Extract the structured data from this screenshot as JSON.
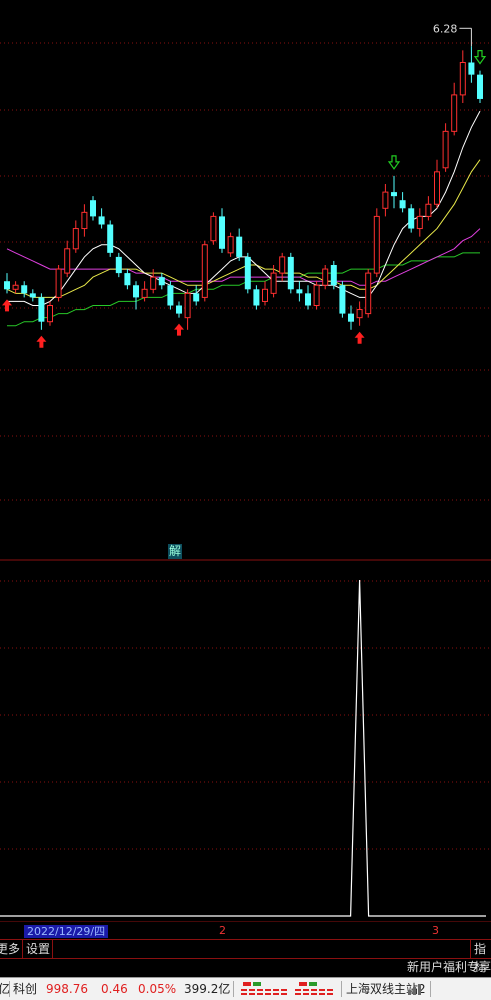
{
  "chart_top": {
    "max_price_label": "6.28",
    "candles": [
      {
        "o": 6,
        "c": 4,
        "h": 8,
        "l": 3
      },
      {
        "o": 4,
        "c": 5,
        "h": 6,
        "l": 3
      },
      {
        "o": 5,
        "c": 3,
        "h": 6,
        "l": 2
      },
      {
        "o": 3,
        "c": 2,
        "h": 4,
        "l": 1
      },
      {
        "o": 2,
        "c": -4,
        "h": 3,
        "l": -6
      },
      {
        "o": -4,
        "c": 0,
        "h": 1,
        "l": -5
      },
      {
        "o": 2,
        "c": 9,
        "h": 10,
        "l": 1
      },
      {
        "o": 8,
        "c": 14,
        "h": 16,
        "l": 7
      },
      {
        "o": 14,
        "c": 19,
        "h": 21,
        "l": 13
      },
      {
        "o": 19,
        "c": 23,
        "h": 25,
        "l": 17
      },
      {
        "o": 26,
        "c": 22,
        "h": 27,
        "l": 21
      },
      {
        "o": 22,
        "c": 20,
        "h": 24,
        "l": 19
      },
      {
        "o": 20,
        "c": 13,
        "h": 21,
        "l": 12
      },
      {
        "o": 12,
        "c": 8,
        "h": 13,
        "l": 7
      },
      {
        "o": 8,
        "c": 5,
        "h": 9,
        "l": 4
      },
      {
        "o": 5,
        "c": 2,
        "h": 6,
        "l": -1
      },
      {
        "o": 2,
        "c": 4,
        "h": 6,
        "l": 1
      },
      {
        "o": 4,
        "c": 7,
        "h": 9,
        "l": 3
      },
      {
        "o": 7,
        "c": 5,
        "h": 8,
        "l": 4
      },
      {
        "o": 5,
        "c": 0,
        "h": 6,
        "l": -1
      },
      {
        "o": 0,
        "c": -2,
        "h": 1,
        "l": -3
      },
      {
        "o": -3,
        "c": 3,
        "h": 4,
        "l": -6
      },
      {
        "o": 3,
        "c": 1,
        "h": 5,
        "l": 0
      },
      {
        "o": 2,
        "c": 15,
        "h": 16,
        "l": 1
      },
      {
        "o": 16,
        "c": 22,
        "h": 23,
        "l": 15
      },
      {
        "o": 22,
        "c": 14,
        "h": 24,
        "l": 13
      },
      {
        "o": 13,
        "c": 17,
        "h": 18,
        "l": 12
      },
      {
        "o": 17,
        "c": 12,
        "h": 19,
        "l": 11
      },
      {
        "o": 12,
        "c": 4,
        "h": 13,
        "l": 3
      },
      {
        "o": 4,
        "c": 0,
        "h": 5,
        "l": -1
      },
      {
        "o": 1,
        "c": 4,
        "h": 6,
        "l": 0
      },
      {
        "o": 3,
        "c": 8,
        "h": 10,
        "l": 2
      },
      {
        "o": 8,
        "c": 12,
        "h": 13,
        "l": 6
      },
      {
        "o": 12,
        "c": 4,
        "h": 13,
        "l": 3
      },
      {
        "o": 4,
        "c": 3,
        "h": 6,
        "l": 1
      },
      {
        "o": 3,
        "c": 0,
        "h": 5,
        "l": -1
      },
      {
        "o": 0,
        "c": 5,
        "h": 6,
        "l": -1
      },
      {
        "o": 5,
        "c": 9,
        "h": 10,
        "l": 4
      },
      {
        "o": 10,
        "c": 5,
        "h": 11,
        "l": 4
      },
      {
        "o": 5,
        "c": -2,
        "h": 6,
        "l": -3
      },
      {
        "o": -2,
        "c": -4,
        "h": 0,
        "l": -6
      },
      {
        "o": -3,
        "c": -1,
        "h": 1,
        "l": -5
      },
      {
        "o": -2,
        "c": 8,
        "h": 9,
        "l": -3
      },
      {
        "o": 8,
        "c": 22,
        "h": 24,
        "l": 7
      },
      {
        "o": 24,
        "c": 28,
        "h": 30,
        "l": 22
      },
      {
        "o": 28,
        "c": 27,
        "h": 32,
        "l": 24
      },
      {
        "o": 26,
        "c": 24,
        "h": 28,
        "l": 23
      },
      {
        "o": 24,
        "c": 19,
        "h": 25,
        "l": 18
      },
      {
        "o": 19,
        "c": 22,
        "h": 24,
        "l": 17
      },
      {
        "o": 22,
        "c": 25,
        "h": 27,
        "l": 21
      },
      {
        "o": 25,
        "c": 33,
        "h": 36,
        "l": 24
      },
      {
        "o": 34,
        "c": 43,
        "h": 45,
        "l": 33
      },
      {
        "o": 43,
        "c": 52,
        "h": 55,
        "l": 42
      },
      {
        "o": 52,
        "c": 60,
        "h": 63,
        "l": 50
      },
      {
        "o": 60,
        "c": 57,
        "h": 64,
        "l": 55
      },
      {
        "o": 57,
        "c": 51,
        "h": 58,
        "l": 50
      }
    ],
    "ma_white": [
      1,
      1,
      1,
      0,
      0,
      1,
      3,
      6,
      9,
      12,
      14,
      15,
      15,
      14,
      12,
      10,
      8,
      7,
      6,
      5,
      4,
      3,
      3,
      5,
      7,
      9,
      11,
      12,
      12,
      10,
      8,
      6,
      6,
      6,
      6,
      6,
      5,
      5,
      5,
      4,
      3,
      2,
      2,
      5,
      10,
      15,
      19,
      21,
      22,
      22,
      24,
      28,
      33,
      39,
      44,
      48
    ],
    "ma_yellow": [
      4,
      3,
      3,
      2,
      2,
      2,
      2,
      3,
      4,
      5,
      7,
      8,
      9,
      9,
      9,
      9,
      8,
      8,
      8,
      7,
      6,
      5,
      5,
      5,
      6,
      7,
      8,
      9,
      10,
      10,
      9,
      9,
      8,
      8,
      8,
      7,
      7,
      6,
      6,
      5,
      5,
      4,
      4,
      5,
      7,
      9,
      11,
      13,
      15,
      17,
      19,
      22,
      25,
      29,
      33,
      36
    ],
    "ma_pink": [
      14,
      13,
      12,
      11,
      10,
      9,
      9,
      9,
      9,
      9,
      9,
      9,
      9,
      9,
      9,
      8,
      8,
      7,
      7,
      6,
      6,
      6,
      6,
      6,
      6,
      6,
      7,
      7,
      7,
      7,
      7,
      7,
      7,
      7,
      7,
      6,
      6,
      6,
      6,
      6,
      6,
      5,
      5,
      6,
      6,
      7,
      8,
      9,
      10,
      11,
      12,
      13,
      14,
      16,
      17,
      19
    ],
    "ma_green": [
      -5,
      -5,
      -4,
      -4,
      -3,
      -3,
      -2,
      -2,
      -1,
      -1,
      0,
      0,
      0,
      1,
      1,
      1,
      2,
      2,
      2,
      3,
      3,
      3,
      4,
      4,
      4,
      5,
      5,
      5,
      6,
      6,
      6,
      7,
      7,
      7,
      7,
      8,
      8,
      8,
      8,
      8,
      9,
      9,
      9,
      9,
      10,
      10,
      10,
      11,
      11,
      11,
      12,
      12,
      12,
      13,
      13,
      13
    ],
    "signals": [
      {
        "i": 0,
        "dir": "up",
        "color": "#ff2020"
      },
      {
        "i": 4,
        "dir": "up",
        "color": "#ff2020"
      },
      {
        "i": 20,
        "dir": "up",
        "color": "#ff2020"
      },
      {
        "i": 41,
        "dir": "up",
        "color": "#ff2020"
      },
      {
        "i": 45,
        "dir": "down",
        "color": "#22cc22"
      },
      {
        "i": 55,
        "dir": "down",
        "color": "#22cc22"
      }
    ]
  },
  "chart_bottom": {
    "spike_index": 41,
    "button_label": "解"
  },
  "colors": {
    "up": "#ff3030",
    "down": "#54ffff",
    "grid": "#8a1010",
    "ma_white": "#ffffff",
    "ma_yellow": "#e8e84a",
    "ma_pink": "#e040e0",
    "ma_green": "#28c828"
  },
  "axis": {
    "date_label": "2022/12/29/四",
    "marks": [
      "2",
      "3"
    ]
  },
  "tabs": [
    "更多",
    "设置",
    "指标"
  ],
  "notice": "新用户福利专享",
  "status": {
    "unit_left": "亿",
    "index_name": "科创",
    "index_value": "998.76",
    "change": "0.46",
    "change_pct": "0.05%",
    "turnover": "399.2亿",
    "server": "上海双线主站2"
  }
}
